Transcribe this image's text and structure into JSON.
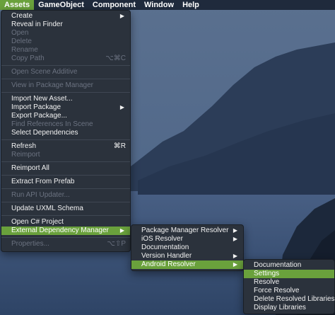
{
  "menubar": {
    "items": [
      {
        "label": "Assets",
        "active": true
      },
      {
        "label": "GameObject",
        "active": false
      },
      {
        "label": "Component",
        "active": false
      },
      {
        "label": "Window",
        "active": false
      },
      {
        "label": "Help",
        "active": false
      }
    ]
  },
  "assets_menu": {
    "create": "Create",
    "reveal_in_finder": "Reveal in Finder",
    "open": "Open",
    "delete": "Delete",
    "rename": "Rename",
    "copy_path": "Copy Path",
    "copy_path_shortcut": "⌥⌘C",
    "open_scene_additive": "Open Scene Additive",
    "view_in_package_manager": "View in Package Manager",
    "import_new_asset": "Import New Asset...",
    "import_package": "Import Package",
    "export_package": "Export Package...",
    "find_references": "Find References In Scene",
    "select_dependencies": "Select Dependencies",
    "refresh": "Refresh",
    "refresh_shortcut": "⌘R",
    "reimport": "Reimport",
    "reimport_all": "Reimport All",
    "extract_from_prefab": "Extract From Prefab",
    "run_api_updater": "Run API Updater...",
    "update_uxml_schema": "Update UXML Schema",
    "open_csharp_project": "Open C# Project",
    "external_dependency_manager": "External Dependency Manager",
    "properties": "Properties...",
    "properties_shortcut": "⌥⇧P"
  },
  "edm_menu": {
    "package_manager_resolver": "Package Manager Resolver",
    "ios_resolver": "iOS Resolver",
    "documentation": "Documentation",
    "version_handler": "Version Handler",
    "android_resolver": "Android Resolver"
  },
  "android_menu": {
    "documentation": "Documentation",
    "settings": "Settings",
    "resolve": "Resolve",
    "force_resolve": "Force Resolve",
    "delete_resolved_libraries": "Delete Resolved Libraries",
    "display_libraries": "Display Libraries"
  },
  "icons": {
    "submenu_arrow": "chevron-right-icon"
  },
  "colors": {
    "highlight": "#6aa13c",
    "menu_bg": "#2b323c",
    "menubar_bg": "#1f2a3c"
  }
}
